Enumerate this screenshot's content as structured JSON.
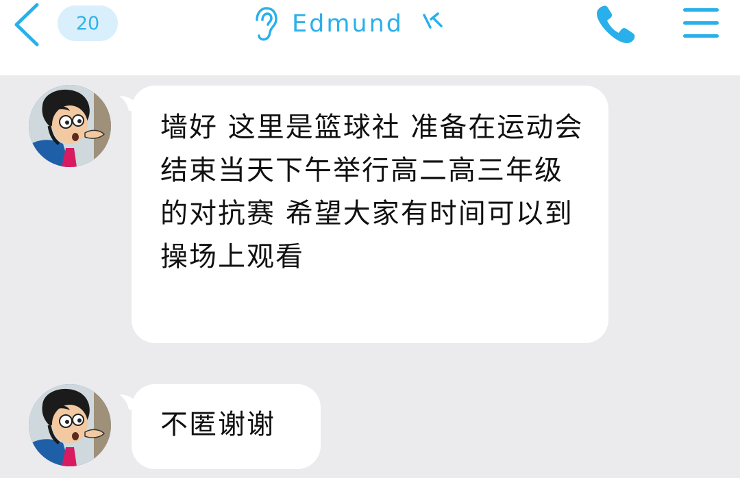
{
  "header": {
    "back_icon": "chevron-left-icon",
    "unread_count": "20",
    "contact_name": "Edmund",
    "ear_icon": "ear-icon",
    "vip_icon": "vip-badge-icon",
    "call_icon": "phone-icon",
    "menu_icon": "hamburger-menu-icon",
    "accent_color": "#29b0ea"
  },
  "messages": [
    {
      "sender": "Edmund",
      "avatar_icon": "cartoon-avatar",
      "text": "墙好 这里是篮球社 准备在运动会结束当天下午举行高二高三年级的对抗赛 希望大家有时间可以到操场上观看"
    },
    {
      "sender": "Edmund",
      "avatar_icon": "cartoon-avatar",
      "text": "不匿谢谢"
    }
  ],
  "colors": {
    "background": "#ebebee",
    "bubble": "#ffffff",
    "header": "#ffffff",
    "badge_bg": "#d9effc"
  }
}
